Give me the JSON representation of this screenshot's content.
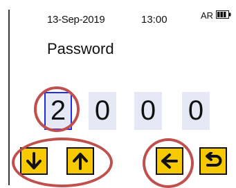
{
  "status": {
    "date": "13-Sep-2019",
    "time": "13:00",
    "language": "AR",
    "battery_icon": "battery-full-icon"
  },
  "title": "Password",
  "password_digits": [
    "2",
    "0",
    "0",
    "0"
  ],
  "active_digit_index": 0,
  "soft_keys": [
    {
      "icon": "arrow-down-icon"
    },
    {
      "icon": "arrow-up-icon"
    },
    {
      "icon": "arrow-left-icon"
    },
    {
      "icon": "return-icon"
    }
  ],
  "colors": {
    "key_fill": "#f6c900",
    "digit_bg": "#e6e8f6",
    "active_border": "#1f2ee0",
    "annotation": "#c0504d"
  }
}
